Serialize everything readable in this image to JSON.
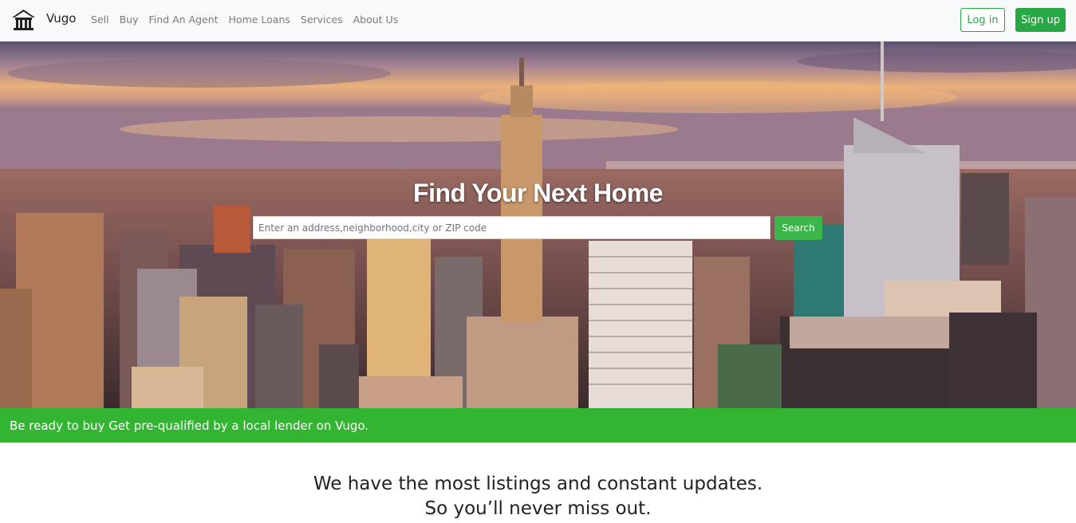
{
  "brand": {
    "name": "Vugo",
    "icon": "house-icon"
  },
  "nav": {
    "links": [
      "Sell",
      "Buy",
      "Find An Agent",
      "Home Loans",
      "Services",
      "About Us"
    ],
    "login_label": "Log in",
    "signup_label": "Sign up"
  },
  "hero": {
    "title": "Find Your Next Home",
    "search_placeholder": "Enter an address,neighborhood,city or ZIP code",
    "search_button": "Search"
  },
  "banner": {
    "text": "Be ready to buy Get pre-qualified by a local lender on Vugo."
  },
  "tagline": {
    "line1": "We have the most listings and constant updates.",
    "line2": "So you’ll never miss out."
  },
  "colors": {
    "accent": "#28a745",
    "banner": "#33b533",
    "navbar_bg": "#f8f9fa"
  }
}
